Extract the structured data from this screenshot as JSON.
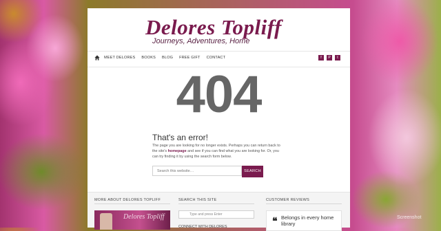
{
  "site": {
    "logo_title": "Delores Topliff",
    "logo_subtitle": "Journeys, Adventures, Home"
  },
  "nav": {
    "home_icon": "home-icon",
    "items": [
      "MEET DELORES",
      "BOOKS",
      "BLOG",
      "FREE GIFT",
      "CONTACT"
    ],
    "social": [
      {
        "icon": "facebook-icon",
        "glyph": "f"
      },
      {
        "icon": "pinterest-icon",
        "glyph": "P"
      },
      {
        "icon": "twitter-icon",
        "glyph": "t"
      }
    ]
  },
  "error": {
    "code": "404",
    "title": "That's an error!",
    "text_before": "The page you are looking for no longer exists. Perhaps you can return back to the site's ",
    "link": "homepage",
    "text_after": " and see if you can find what you are looking for. Or, you can try finding it by using the search form below.",
    "search_placeholder": "Search this website…",
    "search_button": "SEARCH"
  },
  "footer": {
    "about_heading": "MORE ABOUT DELORES TOPLIFF",
    "search_heading": "SEARCH THIS SITE",
    "search_placeholder": "Type and press Enter",
    "connect_heading": "CONNECT WITH DELORES",
    "reviews_heading": "CUSTOMER REVIEWS",
    "review_text": "Belongs in every home library"
  },
  "watermark": "Screenshot"
}
